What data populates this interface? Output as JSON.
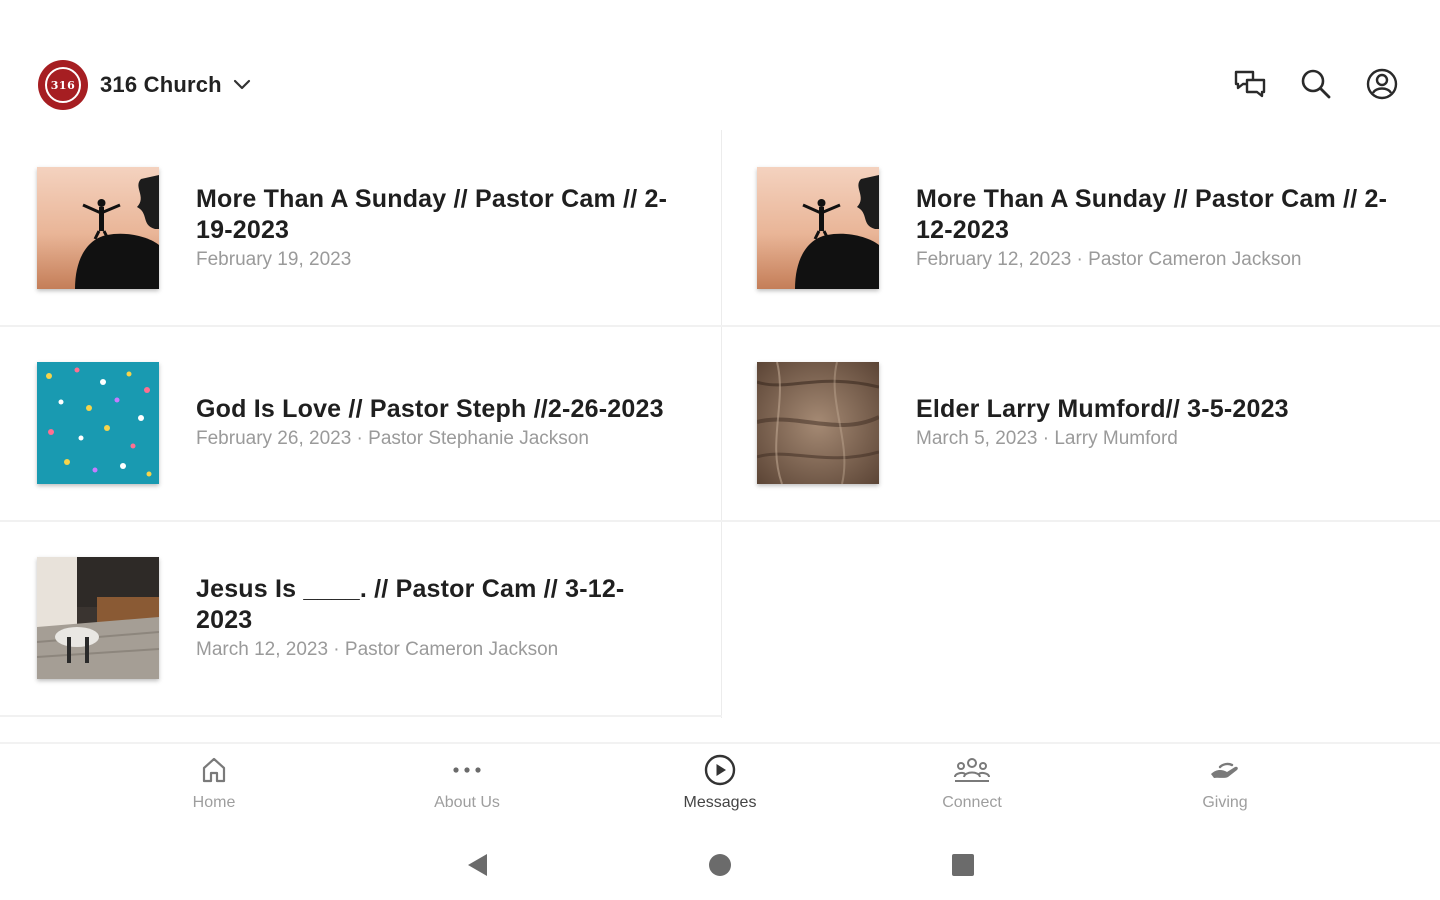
{
  "header": {
    "church_name": "316 Church",
    "logo_text": "316",
    "icons": [
      "chat-icon",
      "search-icon",
      "account-icon"
    ]
  },
  "messages": [
    {
      "title": "More Than A Sunday // Pastor Cam // 2-19-2023",
      "meta": "February 19, 2023",
      "thumb": "silhouette"
    },
    {
      "title": "More Than A Sunday // Pastor Cam // 2-12-2023",
      "meta": "February 12, 2023 · Pastor Cameron Jackson",
      "thumb": "silhouette"
    },
    {
      "title": "God Is Love // Pastor Steph //2-26-2023",
      "meta": "February 26, 2023 · Pastor Stephanie Jackson",
      "thumb": "teal-confetti"
    },
    {
      "title": "Elder Larry Mumford// 3-5-2023",
      "meta": "March 5, 2023 · Larry Mumford",
      "thumb": "brown-texture"
    },
    {
      "title": "Jesus Is ____. // Pastor Cam // 3-12-2023",
      "meta": "March 12, 2023 · Pastor Cameron Jackson",
      "thumb": "room-interior"
    }
  ],
  "tabs": [
    {
      "label": "Home",
      "icon": "home-icon",
      "active": false
    },
    {
      "label": "About Us",
      "icon": "more-dots-icon",
      "active": false
    },
    {
      "label": "Messages",
      "icon": "play-circle-icon",
      "active": true
    },
    {
      "label": "Connect",
      "icon": "people-icon",
      "active": false
    },
    {
      "label": "Giving",
      "icon": "giving-hand-icon",
      "active": false
    }
  ],
  "system_nav": [
    "back-icon",
    "home-circle-icon",
    "recents-icon"
  ],
  "colors": {
    "brand": "#a61e22",
    "title_text": "#1f1f1f",
    "meta_text": "#9a9a9a",
    "tab_inactive": "#9e9e9e",
    "tab_active": "#444444"
  }
}
